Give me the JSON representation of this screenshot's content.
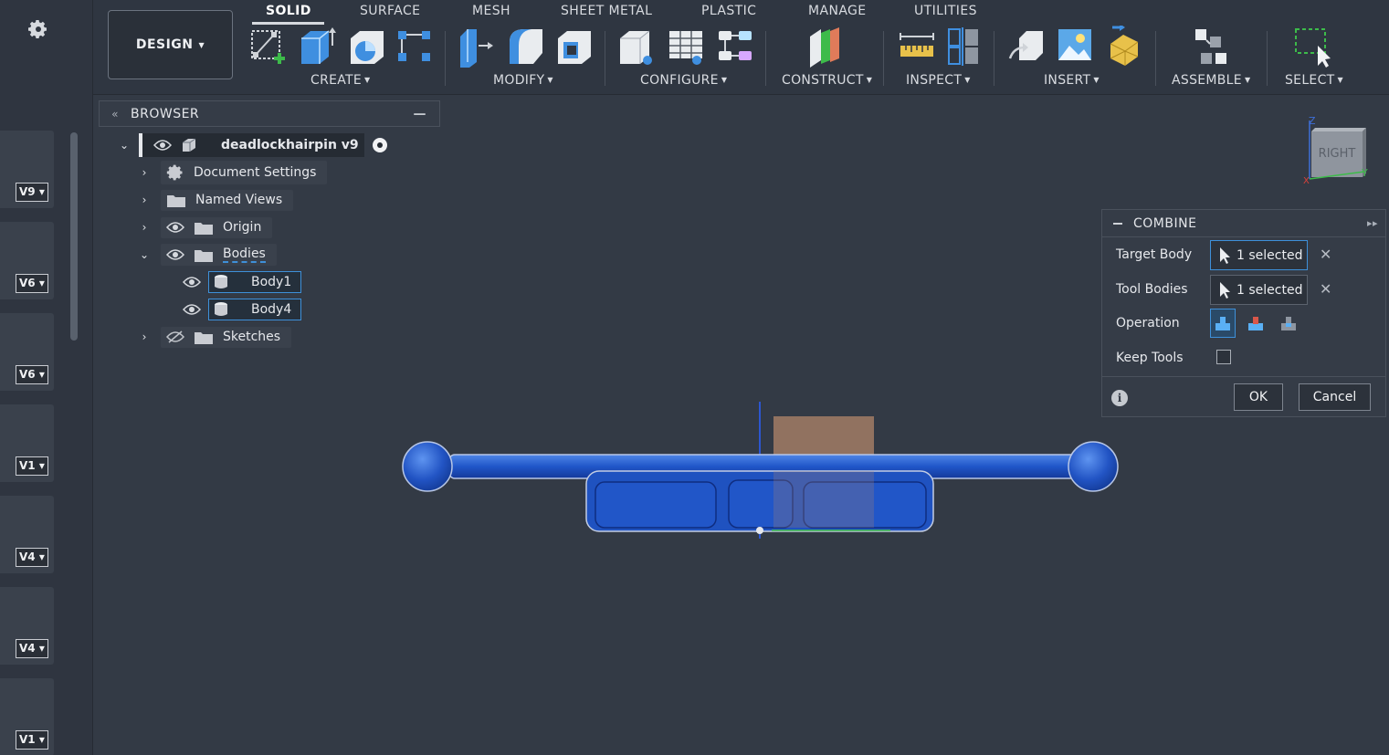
{
  "versions": [
    {
      "label": "V9"
    },
    {
      "label": "V6"
    },
    {
      "label": "V6"
    },
    {
      "label": "V1"
    },
    {
      "label": "V4"
    },
    {
      "label": "V4"
    },
    {
      "label": "V1"
    }
  ],
  "toolbar": {
    "workspace": "DESIGN",
    "tabs": [
      "SOLID",
      "SURFACE",
      "MESH",
      "SHEET METAL",
      "PLASTIC",
      "MANAGE",
      "UTILITIES"
    ],
    "groups": [
      "CREATE",
      "MODIFY",
      "CONFIGURE",
      "CONSTRUCT",
      "INSPECT",
      "INSERT",
      "ASSEMBLE",
      "SELECT"
    ]
  },
  "browser": {
    "title": "BROWSER",
    "root": "deadlockhairpin v9",
    "items": [
      "Document Settings",
      "Named Views",
      "Origin",
      "Bodies",
      "Body1",
      "Body4",
      "Sketches"
    ]
  },
  "viewcube": {
    "face": "RIGHT",
    "axes": {
      "z": "Z",
      "y": "Y",
      "x": "X"
    }
  },
  "combine": {
    "title": "COMBINE",
    "target_label": "Target Body",
    "target_value": "1 selected",
    "tool_label": "Tool Bodies",
    "tool_value": "1 selected",
    "operation_label": "Operation",
    "keep_tools_label": "Keep Tools",
    "ok": "OK",
    "cancel": "Cancel",
    "info": "i"
  },
  "icons": {
    "accent": "#3e90d9",
    "body_color": "#1e4fb0"
  }
}
